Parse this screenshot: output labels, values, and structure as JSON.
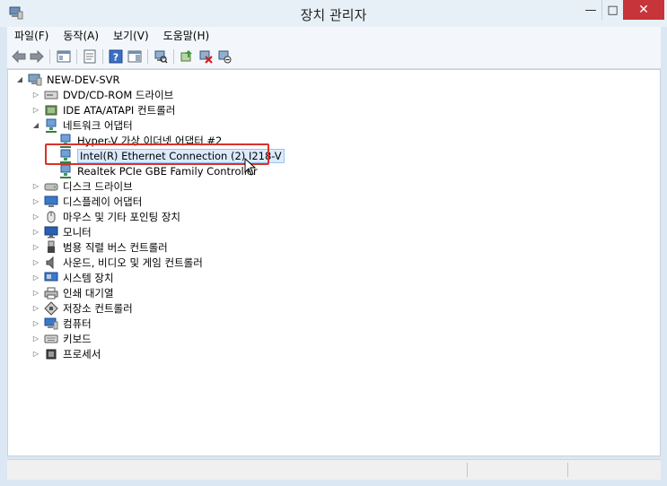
{
  "window": {
    "title": "장치 관리자",
    "controls": {
      "minimize": "—",
      "maximize": "□",
      "close": "✕"
    }
  },
  "menu": [
    "파일(F)",
    "동작(A)",
    "보기(V)",
    "도움말(H)"
  ],
  "tree": {
    "root": "NEW-DEV-SVR",
    "items": [
      {
        "label": "DVD/CD-ROM 드라이브",
        "icon": "dvd-drive-icon"
      },
      {
        "label": "IDE ATA/ATAPI 컨트롤러",
        "icon": "ide-controller-icon"
      },
      {
        "label": "네트워크 어댑터",
        "icon": "network-adapter-icon",
        "children": [
          {
            "label": "Hyper-V 가상 이더넷 어댑터 #2"
          },
          {
            "label": "Intel(R) Ethernet Connection (2) I218-V"
          },
          {
            "label": "Realtek PCIe GBE Family Controller"
          }
        ]
      },
      {
        "label": "디스크 드라이브",
        "icon": "disk-drive-icon"
      },
      {
        "label": "디스플레이 어댑터",
        "icon": "display-adapter-icon"
      },
      {
        "label": "마우스 및 기타 포인팅 장치",
        "icon": "mouse-icon"
      },
      {
        "label": "모니터",
        "icon": "monitor-icon"
      },
      {
        "label": "범용 직렬 버스 컨트롤러",
        "icon": "usb-icon"
      },
      {
        "label": "사운드, 비디오 및 게임 컨트롤러",
        "icon": "speaker-icon"
      },
      {
        "label": "시스템 장치",
        "icon": "system-device-icon"
      },
      {
        "label": "인쇄 대기열",
        "icon": "printer-icon"
      },
      {
        "label": "저장소 컨트롤러",
        "icon": "storage-controller-icon"
      },
      {
        "label": "컴퓨터",
        "icon": "computer-icon"
      },
      {
        "label": "키보드",
        "icon": "keyboard-icon"
      },
      {
        "label": "프로세서",
        "icon": "processor-icon"
      }
    ]
  },
  "colors": {
    "highlight_box": "#d8322c",
    "selection": "#dbeafc",
    "close_button": "#c7343a"
  }
}
